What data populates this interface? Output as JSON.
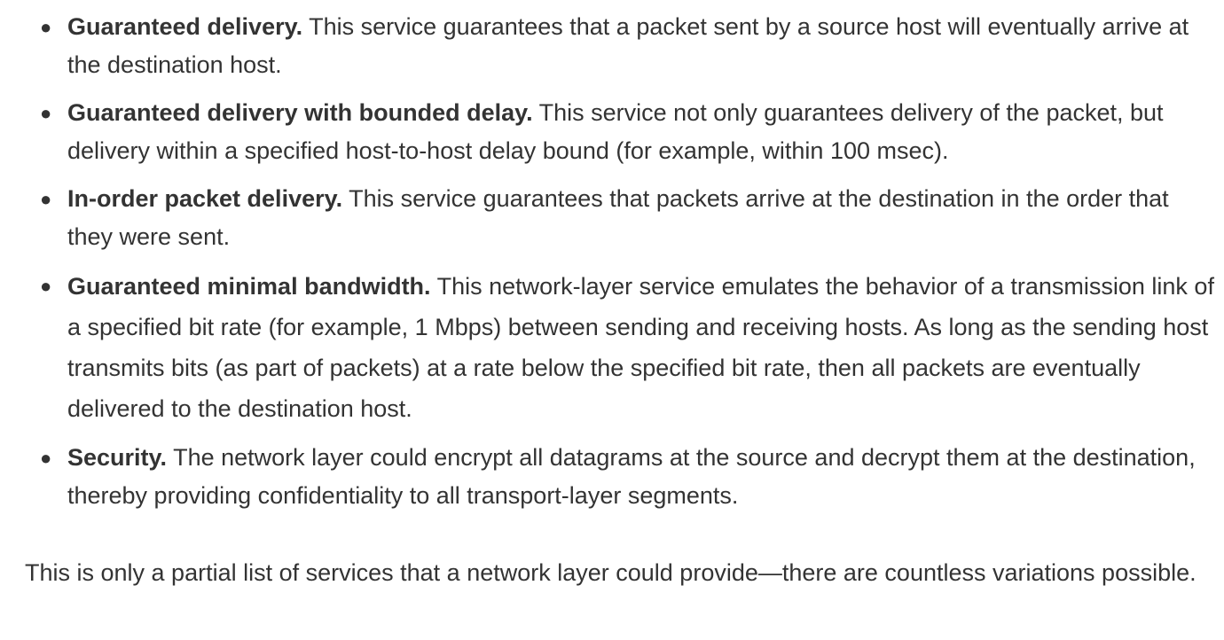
{
  "services": [
    {
      "title": "Guaranteed delivery.",
      "text": " This service guarantees that a packet sent by a source host will eventually arrive at the destination host."
    },
    {
      "title": "Guaranteed delivery with bounded delay.",
      "text": " This service not only guarantees delivery of the packet, but delivery within a specified host-to-host delay bound (for example, within 100 msec)."
    },
    {
      "title": "In-order packet delivery.",
      "text": " This service guarantees that packets arrive at the destination in the order that they were sent."
    },
    {
      "title": "Guaranteed minimal bandwidth.",
      "text": " This network-layer service emulates the behavior of a transmission link of a specified bit rate (for example, 1 Mbps) between sending and receiving hosts. As long as the sending host transmits bits (as part of packets) at a rate below the specified bit rate, then all packets are eventually delivered to the destination host."
    },
    {
      "title": "Security.",
      "text": " The network layer could encrypt all datagrams at the source and decrypt them at the destination, thereby providing confidentiality to all transport-layer segments."
    }
  ],
  "paragraph": "This is only a partial list of services that a network layer could provide—there are countless variations possible."
}
